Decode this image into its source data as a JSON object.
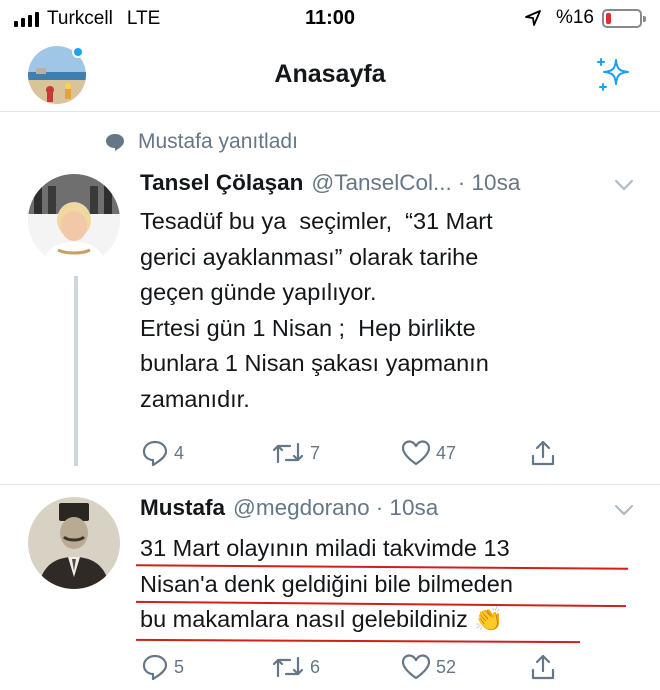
{
  "status_bar": {
    "carrier": "Turkcell",
    "network": "LTE",
    "time": "11:00",
    "battery": "%16",
    "battery_level": 0.16
  },
  "header": {
    "title": "Anasayfa"
  },
  "thread": {
    "context_label": "Mustafa yanıtladı",
    "tweets": [
      {
        "name": "Tansel Çölaşan",
        "handle": "@TanselCol...",
        "time": "· 10sa",
        "lines": [
          "Tesadüf bu ya  seçimler,  “31 Mart",
          "gerici ayaklanması” olarak tarihe",
          "geçen günde yapılıyor.",
          "Ertesi gün 1 Nisan ;  Hep birlikte",
          "bunlara 1 Nisan şakası yapmanın",
          "zamanıdır."
        ],
        "replies": "4",
        "retweets": "7",
        "likes": "47"
      },
      {
        "name": "Mustafa",
        "handle": "@megdorano",
        "time": "· 10sa",
        "lines": [
          "31 Mart olayının miladi takvimde 13",
          "Nisan'a denk geldiğini bile bilmeden",
          "bu makamlara nasıl gelebildiniz 👏"
        ],
        "replies": "5",
        "retweets": "6",
        "likes": "52"
      }
    ]
  },
  "colors": {
    "accent": "#1da1f2",
    "muted": "#657786",
    "underline": "#d0201a"
  },
  "icons": [
    "signal-icon",
    "location-arrow-icon",
    "battery-icon",
    "sparkle-icon",
    "reply-bubble-icon",
    "chevron-down-icon",
    "reply-icon",
    "retweet-icon",
    "like-icon",
    "share-icon"
  ]
}
